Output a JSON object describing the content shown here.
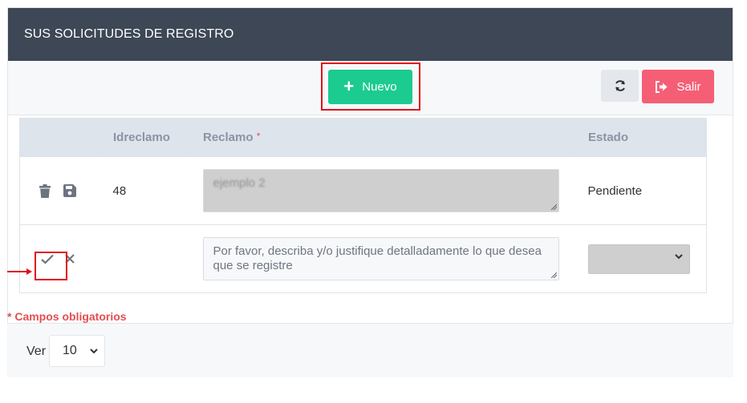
{
  "header": {
    "title": "SUS SOLICITUDES DE REGISTRO"
  },
  "toolbar": {
    "nuevo_label": "Nuevo",
    "salir_label": "Salir"
  },
  "table": {
    "columns": {
      "actions": "",
      "id": "Idreclamo",
      "reclamo": "Reclamo",
      "reclamo_required": "*",
      "estado": "Estado"
    },
    "rows": [
      {
        "id": "48",
        "reclamo": "ejemplo 2",
        "estado": "Pendiente"
      }
    ],
    "new_row": {
      "reclamo_placeholder": "Por favor, describa y/o justifique detalladamente lo que desea que se registre",
      "estado_value": ""
    }
  },
  "footnote": "* Campos obligatorios",
  "pagination": {
    "ver_label": "Ver",
    "page_size": "10"
  },
  "colors": {
    "header_bg": "#3d4756",
    "nuevo": "#1ccb8f",
    "salir": "#f55f76",
    "highlight": "#e0101a"
  }
}
